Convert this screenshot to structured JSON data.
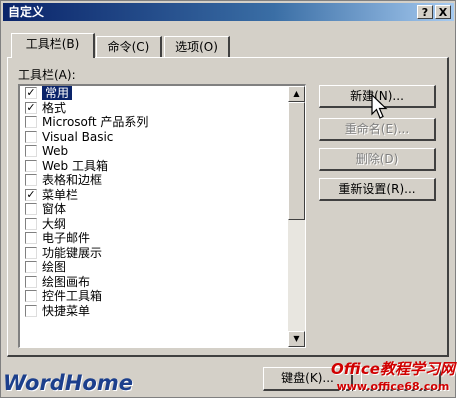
{
  "window": {
    "title": "自定义",
    "help_label": "?",
    "close_label": "X"
  },
  "tabs": [
    {
      "label": "工具栏(B)",
      "active": true
    },
    {
      "label": "命令(C)",
      "active": false
    },
    {
      "label": "选项(O)",
      "active": false
    }
  ],
  "toolbars": {
    "label": "工具栏(A):",
    "items": [
      {
        "label": "常用",
        "checked": true,
        "selected": true
      },
      {
        "label": "格式",
        "checked": true,
        "selected": false
      },
      {
        "label": "Microsoft 产品系列",
        "checked": false,
        "selected": false
      },
      {
        "label": "Visual Basic",
        "checked": false,
        "selected": false
      },
      {
        "label": "Web",
        "checked": false,
        "selected": false
      },
      {
        "label": "Web 工具箱",
        "checked": false,
        "selected": false
      },
      {
        "label": "表格和边框",
        "checked": false,
        "selected": false
      },
      {
        "label": "菜单栏",
        "checked": true,
        "selected": false
      },
      {
        "label": "窗体",
        "checked": false,
        "selected": false
      },
      {
        "label": "大纲",
        "checked": false,
        "selected": false
      },
      {
        "label": "电子邮件",
        "checked": false,
        "selected": false
      },
      {
        "label": "功能键展示",
        "checked": false,
        "selected": false
      },
      {
        "label": "绘图",
        "checked": false,
        "selected": false
      },
      {
        "label": "绘图画布",
        "checked": false,
        "selected": false
      },
      {
        "label": "控件工具箱",
        "checked": false,
        "selected": false
      },
      {
        "label": "快捷菜单",
        "checked": false,
        "selected": false
      }
    ]
  },
  "buttons": {
    "new": "新建(N)...",
    "rename": "重命名(E)...",
    "delete": "删除(D)",
    "reset": "重新设置(R)...",
    "keyboard": "键盘(K)..."
  },
  "watermarks": {
    "left": "WordHome",
    "right_title": "Office教程学习网",
    "right_url": "www.office68.com"
  }
}
